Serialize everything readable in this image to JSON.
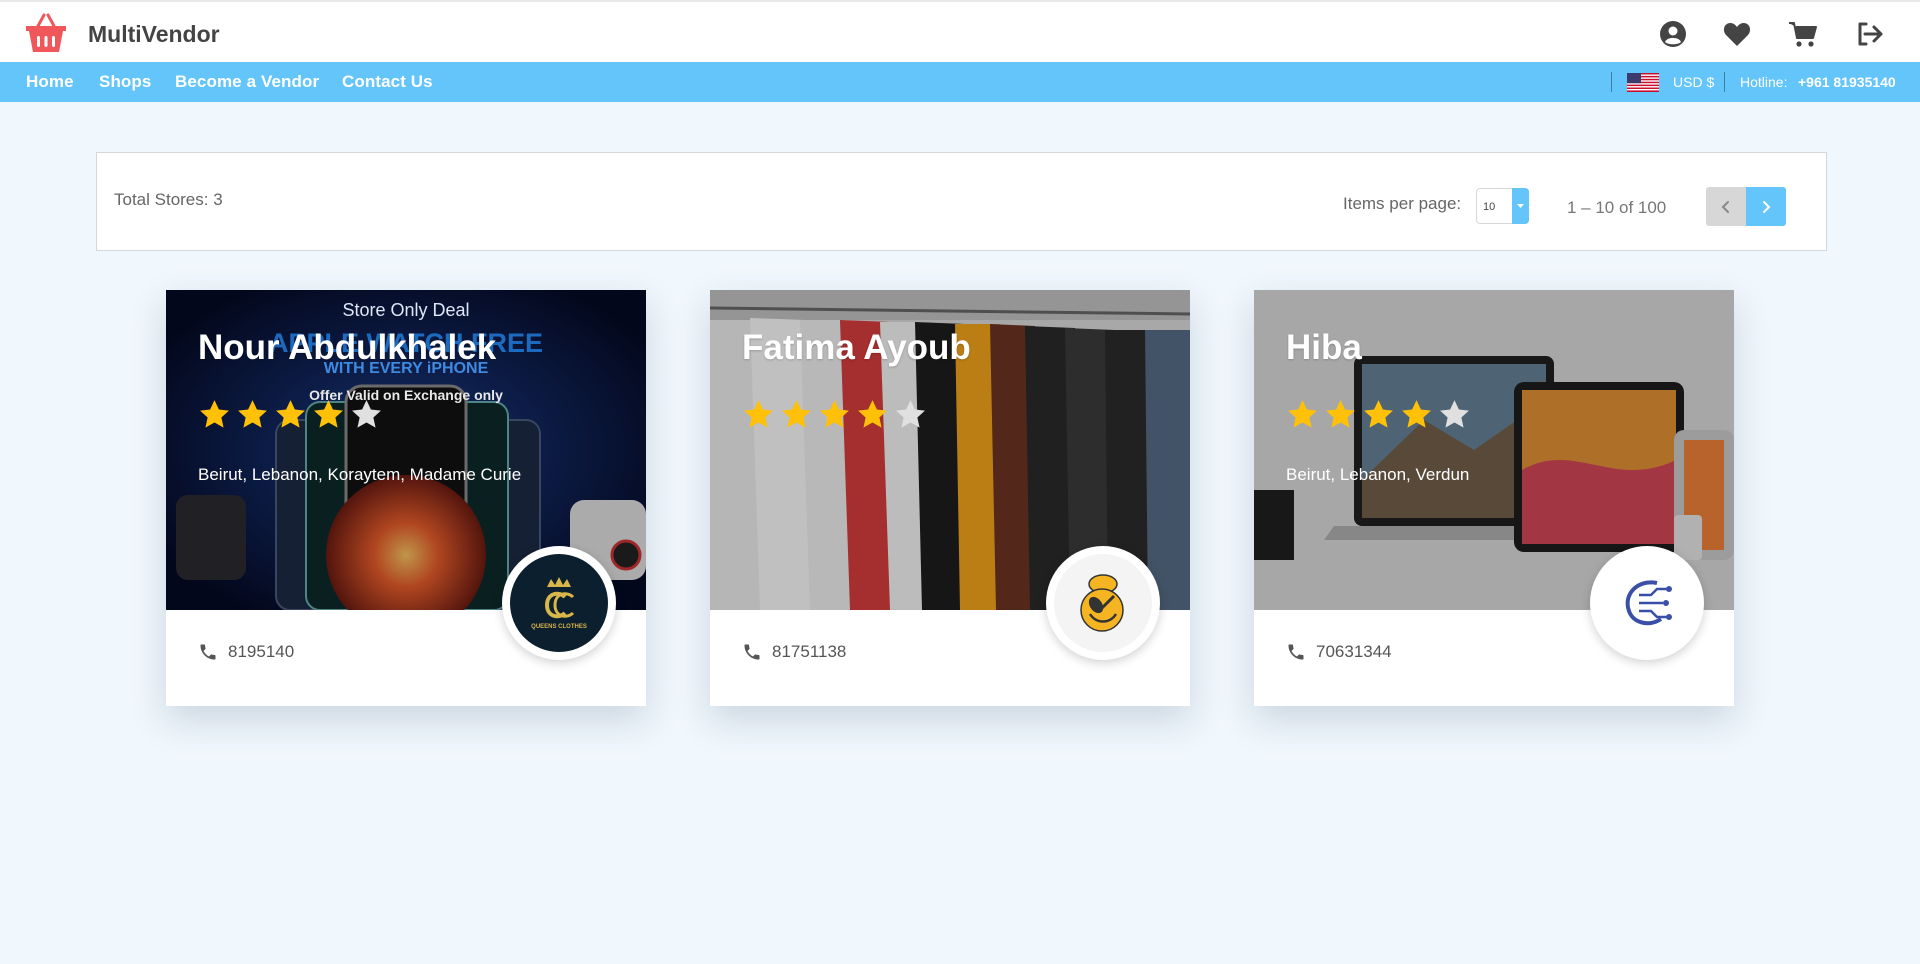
{
  "header": {
    "brand": "MultiVendor",
    "icons": [
      "user-circle-icon",
      "heart-icon",
      "cart-icon",
      "logout-icon"
    ]
  },
  "nav": {
    "items": [
      "Home",
      "Shops",
      "Become a Vendor",
      "Contact Us"
    ],
    "currency": "USD $",
    "hotline_label": "Hotline:",
    "hotline_number": "+961 81935140",
    "accent_color": "#64c5fb"
  },
  "toolbar": {
    "total_stores": "Total Stores: 3",
    "items_per_page_label": "Items per page:",
    "items_per_page_value": "10",
    "range_label": "1 – 10 of 100"
  },
  "stores": [
    {
      "name": "Nour Abdulkhalek",
      "rating": 4,
      "address": "Beirut, Lebanon, Koraytem, Madame Curie",
      "phone": "8195140",
      "banner_text": {
        "line1": "Store Only Deal",
        "line2": "APPLE WATCH FREE",
        "line3": "WITH EVERY iPHONE",
        "line4": "Offer Valid on Exchange only"
      },
      "logo_text": "QUEENS CLOTHES"
    },
    {
      "name": "Fatima Ayoub",
      "rating": 4,
      "address": "",
      "phone": "81751138"
    },
    {
      "name": "Hiba",
      "rating": 4,
      "address": "Beirut, Lebanon, Verdun",
      "phone": "70631344"
    }
  ]
}
